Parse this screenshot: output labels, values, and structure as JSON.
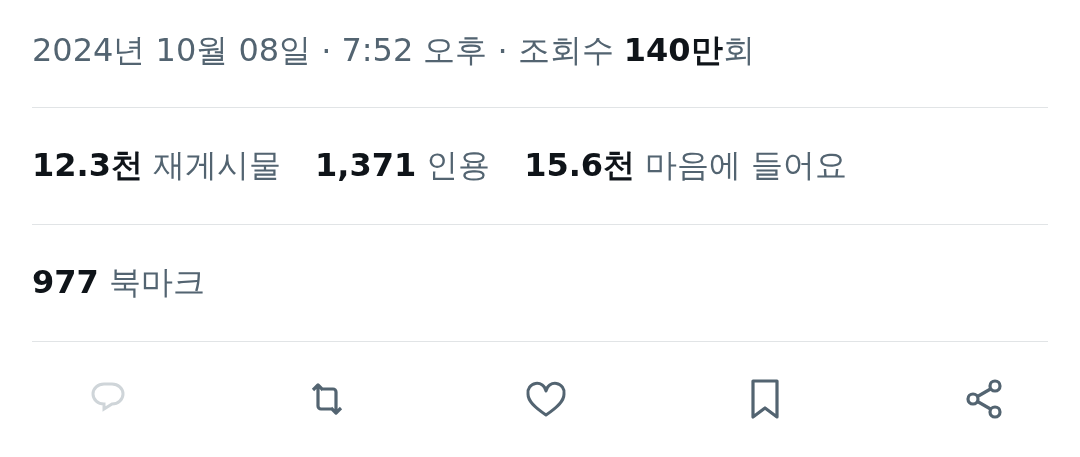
{
  "meta": {
    "date": "2024년 10월 08일",
    "separator_1": "·",
    "time": "7:52 오후",
    "separator_2": "·",
    "views": "조회수 **140만**회"
  },
  "stats": [
    {
      "count": "12.3천",
      "label": "재게시물"
    },
    {
      "count": "1,371",
      "label": "인용"
    },
    {
      "count": "15.6천",
      "label": "마음에 들어요"
    }
  ],
  "bookmarks": {
    "count": "977",
    "label": "북마크"
  },
  "actions": [
    {
      "kind": "reply",
      "disabled": true
    },
    {
      "kind": "repost",
      "disabled": false
    },
    {
      "kind": "like",
      "disabled": false
    },
    {
      "kind": "bookmark",
      "disabled": false
    },
    {
      "kind": "share",
      "disabled": false
    }
  ]
}
